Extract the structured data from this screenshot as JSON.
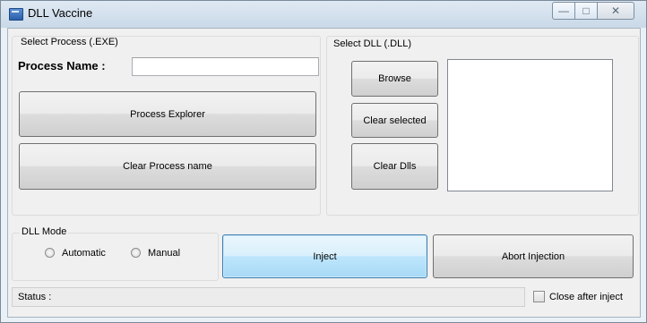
{
  "window": {
    "title": "DLL Vaccine",
    "controls": {
      "minimize": "—",
      "maximize": "□",
      "close": "✕"
    }
  },
  "process_group": {
    "legend": "Select Process (.EXE)",
    "process_name_label": "Process Name :",
    "process_name_value": "",
    "explorer_button": "Process Explorer",
    "clear_button": "Clear Process name"
  },
  "dll_group": {
    "legend": "Select DLL (.DLL)",
    "browse_button": "Browse",
    "clear_selected_button": "Clear selected",
    "clear_dlls_button": "Clear Dlls",
    "dll_list": []
  },
  "mode_group": {
    "legend": "DLL Mode",
    "options": [
      {
        "label": "Automatic",
        "selected": false
      },
      {
        "label": "Manual",
        "selected": false
      }
    ]
  },
  "actions": {
    "inject_button": "Inject",
    "abort_button": "Abort Injection"
  },
  "status_bar": {
    "label": "Status :",
    "value": ""
  },
  "close_after_inject": {
    "label": "Close after inject",
    "checked": false
  }
}
